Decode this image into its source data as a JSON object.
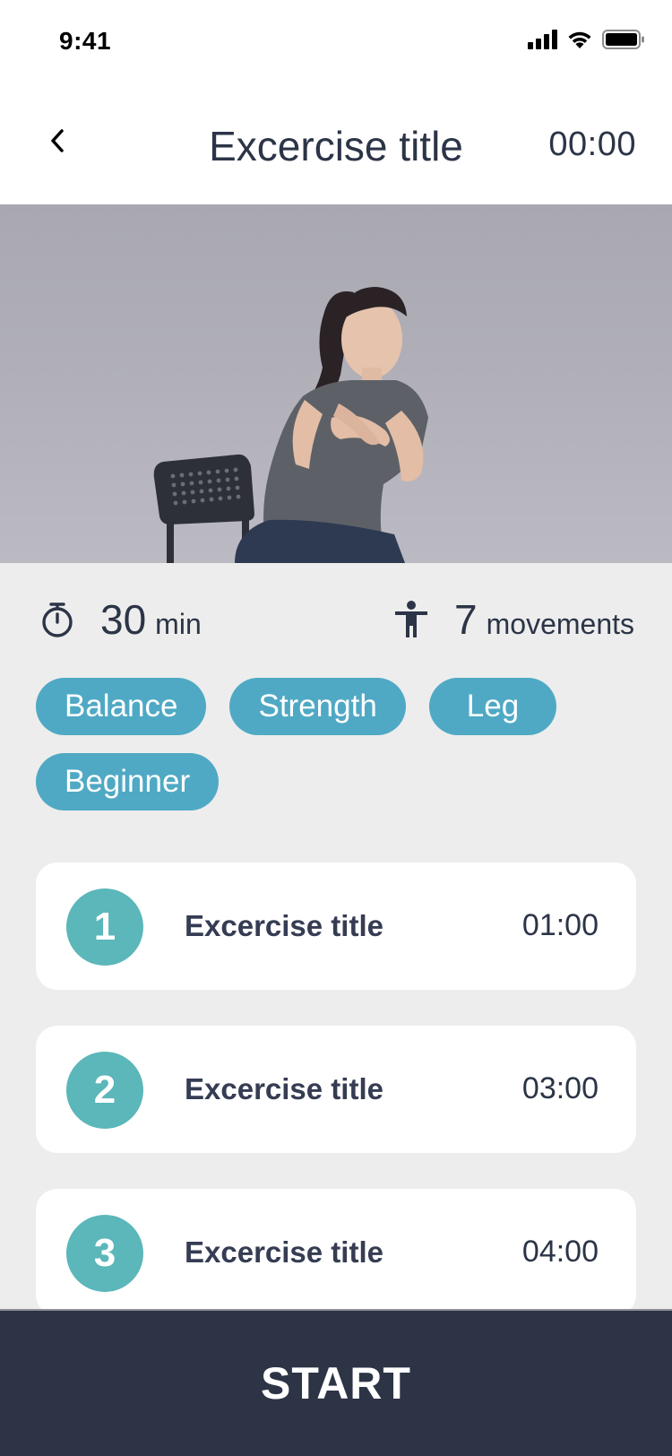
{
  "status_bar": {
    "time": "9:41"
  },
  "header": {
    "title": "Excercise title",
    "timer": "00:00"
  },
  "stats": {
    "duration_value": "30",
    "duration_unit": "min",
    "movements_value": "7",
    "movements_unit": "movements"
  },
  "tags": [
    "Balance",
    "Strength",
    "Leg",
    "Beginner"
  ],
  "exercises": [
    {
      "number": "1",
      "title": "Excercise title",
      "duration": "01:00"
    },
    {
      "number": "2",
      "title": "Excercise title",
      "duration": "03:00"
    },
    {
      "number": "3",
      "title": "Excercise title",
      "duration": "04:00"
    }
  ],
  "start_button": {
    "label": "START"
  },
  "colors": {
    "tag": "#4fa9c4",
    "number_badge": "#5bb7b9",
    "start_bar": "#2d3446",
    "text": "#2c3447"
  }
}
